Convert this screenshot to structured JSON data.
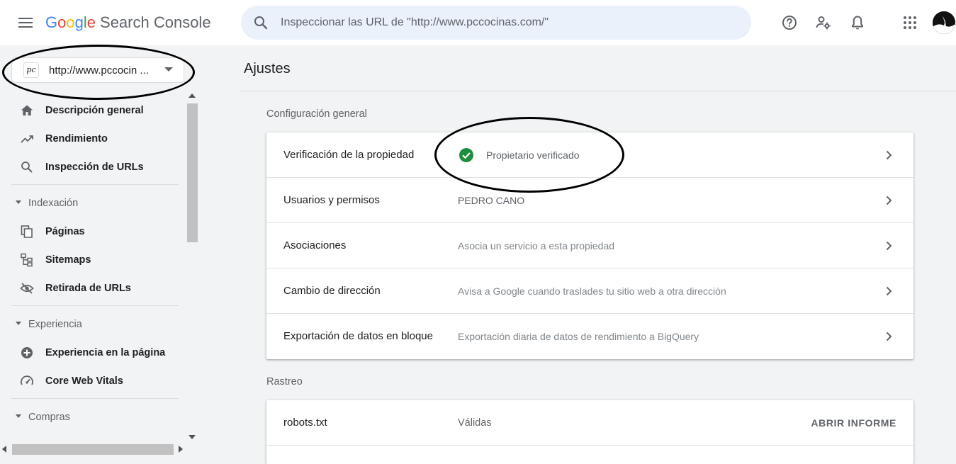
{
  "app": {
    "logo_google": [
      "G",
      "o",
      "o",
      "g",
      "l",
      "e"
    ],
    "logo_product": "Search Console",
    "colors": {
      "blue": "#4285f4",
      "red": "#ea4335",
      "yellow": "#fbbc05",
      "green": "#34a853",
      "check": "#1e8e3e"
    }
  },
  "search": {
    "placeholder": "Inspeccionar las URL de \"http://www.pccocinas.com/\""
  },
  "header_icons": [
    "menu-icon",
    "search-icon",
    "help-icon",
    "manage-users-icon",
    "notifications-icon",
    "apps-icon",
    "avatar"
  ],
  "property": {
    "favicon_text": "pc",
    "label": "http://www.pccocin ..."
  },
  "sidebar": {
    "items": [
      {
        "label": "Descripción general",
        "icon": "home-icon"
      },
      {
        "label": "Rendimiento",
        "icon": "trending-up-icon"
      },
      {
        "label": "Inspección de URLs",
        "icon": "search-icon"
      }
    ],
    "sections": [
      {
        "label": "Indexación",
        "items": [
          {
            "label": "Páginas",
            "icon": "pages-icon"
          },
          {
            "label": "Sitemaps",
            "icon": "sitemap-icon"
          },
          {
            "label": "Retirada de URLs",
            "icon": "visibility-off-icon"
          }
        ]
      },
      {
        "label": "Experiencia",
        "items": [
          {
            "label": "Experiencia en la página",
            "icon": "add-circle-icon"
          },
          {
            "label": "Core Web Vitals",
            "icon": "speed-icon"
          }
        ]
      },
      {
        "label": "Compras",
        "items": []
      }
    ]
  },
  "main": {
    "title": "Ajustes",
    "general": {
      "label": "Configuración general",
      "rows": [
        {
          "label": "Verificación de la propiedad",
          "value": "Propietario verificado"
        },
        {
          "label": "Usuarios y permisos",
          "value": "PEDRO CANO"
        },
        {
          "label": "Asociaciones",
          "value": "Asocia un servicio a esta propiedad"
        },
        {
          "label": "Cambio de dirección",
          "value": "Avisa a Google cuando traslades tu sitio web a otra dirección"
        },
        {
          "label": "Exportación de datos en bloque",
          "value": "Exportación diaria de datos de rendimiento a BigQuery"
        }
      ]
    },
    "crawl": {
      "label": "Rastreo",
      "rows": [
        {
          "label": "robots.txt",
          "value": "Válidas",
          "action": "ABRIR INFORME"
        }
      ]
    }
  }
}
